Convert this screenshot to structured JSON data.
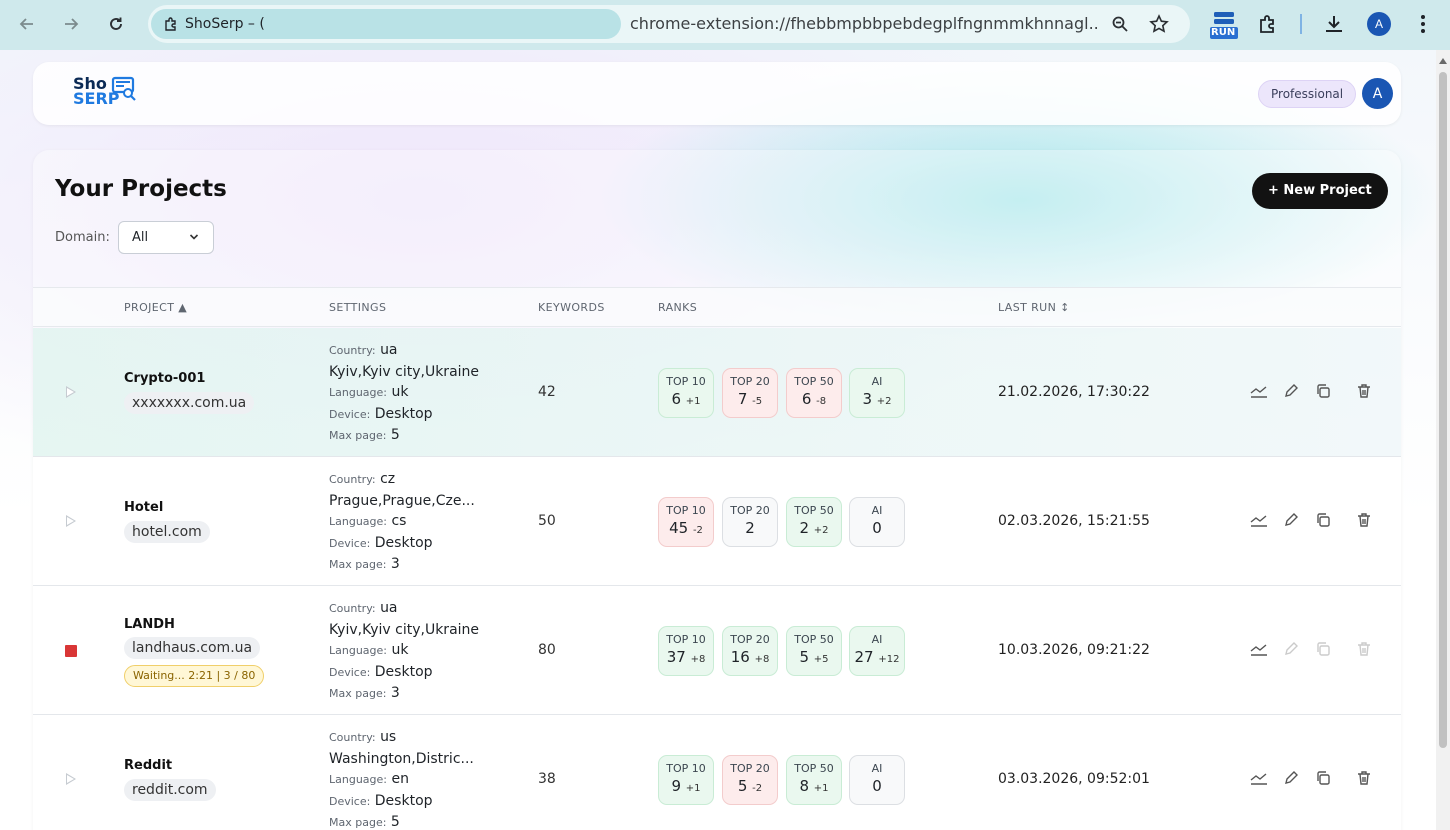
{
  "browser": {
    "tab_title": "ShoSerp – (",
    "url": "chrome-extension://fhebbmpbbpebdegplfngnmmkhnnagl...",
    "extension_label": "RUN",
    "profile_initial": "A"
  },
  "header": {
    "logo_line1": "Sho",
    "logo_line2": "SERP",
    "plan": "Professional",
    "avatar_initial": "A"
  },
  "projects_page": {
    "title": "Your Projects",
    "new_project_label": "+ New Project",
    "domain_label": "Domain:",
    "domain_value": "All",
    "columns": {
      "project": "PROJECT ▲",
      "settings": "SETTINGS",
      "keywords": "KEYWORDS",
      "ranks": "RANKS",
      "last_run": "LAST RUN ↕"
    },
    "settings_labels": {
      "country": "Country:",
      "language": "Language:",
      "device": "Device:",
      "max_page": "Max page:"
    },
    "rows": [
      {
        "name": "Crypto-001",
        "domain": "xxxxxxx.com.ua",
        "status": "idle",
        "country": "ua",
        "location": "Kyiv,Kyiv city,Ukraine",
        "language": "uk",
        "device": "Desktop",
        "max_page": "5",
        "keywords": "42",
        "ranks": [
          {
            "label": "TOP 10",
            "value": "6",
            "delta": "+1",
            "tone": "green"
          },
          {
            "label": "TOP 20",
            "value": "7",
            "delta": "-5",
            "tone": "red"
          },
          {
            "label": "TOP 50",
            "value": "6",
            "delta": "-8",
            "tone": "red"
          },
          {
            "label": "AI",
            "value": "3",
            "delta": "+2",
            "tone": "green"
          }
        ],
        "last_run": "21.02.2026, 17:30:22"
      },
      {
        "name": "Hotel",
        "domain": "hotel.com",
        "status": "idle",
        "country": "cz",
        "location": "Prague,Prague,Cze...",
        "language": "cs",
        "device": "Desktop",
        "max_page": "3",
        "keywords": "50",
        "ranks": [
          {
            "label": "TOP 10",
            "value": "45",
            "delta": "-2",
            "tone": "red"
          },
          {
            "label": "TOP 20",
            "value": "2",
            "delta": "",
            "tone": "neutral"
          },
          {
            "label": "TOP 50",
            "value": "2",
            "delta": "+2",
            "tone": "green"
          },
          {
            "label": "AI",
            "value": "0",
            "delta": "",
            "tone": "neutral"
          }
        ],
        "last_run": "02.03.2026, 15:21:55"
      },
      {
        "name": "LANDH",
        "domain": "landhaus.com.ua",
        "status": "running",
        "waiting": "Waiting... 2:21  |  3 / 80",
        "country": "ua",
        "location": "Kyiv,Kyiv city,Ukraine",
        "language": "uk",
        "device": "Desktop",
        "max_page": "3",
        "keywords": "80",
        "ranks": [
          {
            "label": "TOP 10",
            "value": "37",
            "delta": "+8",
            "tone": "green"
          },
          {
            "label": "TOP 20",
            "value": "16",
            "delta": "+8",
            "tone": "green"
          },
          {
            "label": "TOP 50",
            "value": "5",
            "delta": "+5",
            "tone": "green"
          },
          {
            "label": "AI",
            "value": "27",
            "delta": "+12",
            "tone": "green"
          }
        ],
        "last_run": "10.03.2026, 09:21:22"
      },
      {
        "name": "Reddit",
        "domain": "reddit.com",
        "status": "idle",
        "country": "us",
        "location": "Washington,Distric...",
        "language": "en",
        "device": "Desktop",
        "max_page": "5",
        "keywords": "38",
        "ranks": [
          {
            "label": "TOP 10",
            "value": "9",
            "delta": "+1",
            "tone": "green"
          },
          {
            "label": "TOP 20",
            "value": "5",
            "delta": "-2",
            "tone": "red"
          },
          {
            "label": "TOP 50",
            "value": "8",
            "delta": "+1",
            "tone": "green"
          },
          {
            "label": "AI",
            "value": "0",
            "delta": "",
            "tone": "neutral"
          }
        ],
        "last_run": "03.03.2026, 09:52:01"
      }
    ]
  },
  "colors": {
    "accent": "#1a56b3",
    "positive": "#eaf8ef",
    "negative": "#fdecec",
    "running": "#d93636",
    "primary_button": "#121212"
  }
}
